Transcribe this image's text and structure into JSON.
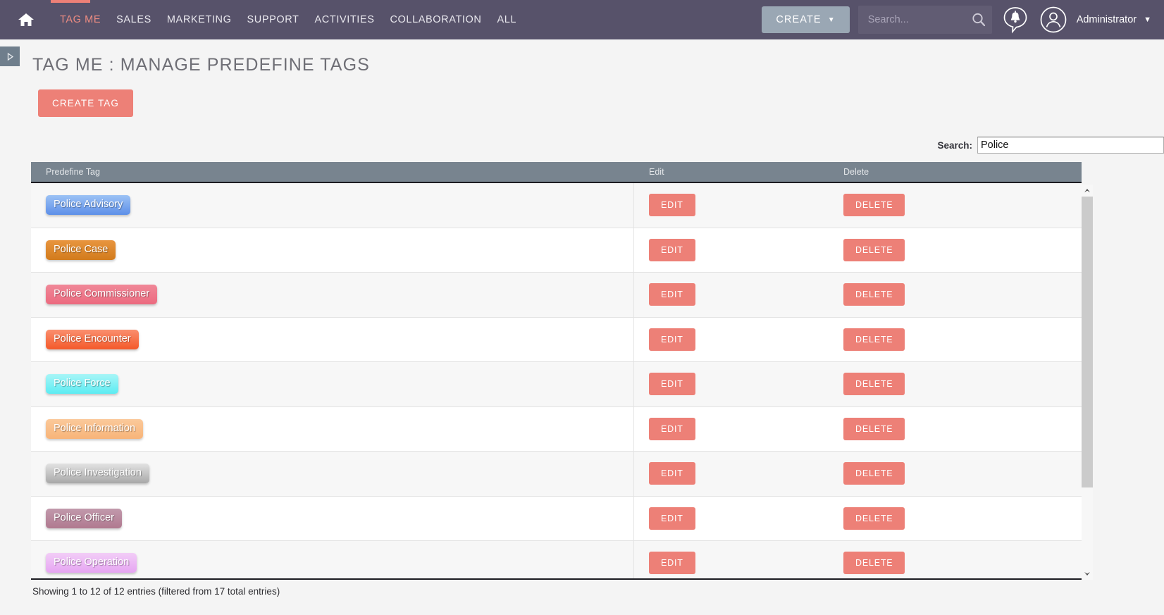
{
  "topnav": {
    "home_icon": "home-icon",
    "links": [
      {
        "label": "TAG ME",
        "active": true
      },
      {
        "label": "SALES",
        "active": false
      },
      {
        "label": "MARKETING",
        "active": false
      },
      {
        "label": "SUPPORT",
        "active": false
      },
      {
        "label": "ACTIVITIES",
        "active": false
      },
      {
        "label": "COLLABORATION",
        "active": false
      },
      {
        "label": "ALL",
        "active": false
      }
    ],
    "create_button": "CREATE",
    "create_caret": "▼",
    "search_placeholder": "Search...",
    "search_value": "",
    "search_icon": "search-icon",
    "notifications_icon": "notification-bell-icon",
    "account_icon": "user-avatar-icon",
    "account_name": "Administrator",
    "account_caret": "▼",
    "accent_color": "#ed8077",
    "bar_color": "#57526a"
  },
  "sidebar_toggle": {
    "icon": "expand-sidebar-icon",
    "glyph": "▷"
  },
  "page": {
    "title": "TAG ME : MANAGE PREDEFINE TAGS",
    "create_tag_label": "CREATE TAG"
  },
  "filter": {
    "label": "Search:",
    "value": "Police",
    "placeholder": ""
  },
  "table": {
    "columns": [
      "Predefine Tag",
      "Edit",
      "Delete"
    ],
    "edit_label": "EDIT",
    "delete_label": "DELETE",
    "rows": [
      {
        "tag": "Police Advisory",
        "color_top": "#9cc2f5",
        "color_bottom": "#5d8fe8"
      },
      {
        "tag": "Police Case",
        "color_top": "#e8953f",
        "color_bottom": "#d27b1c"
      },
      {
        "tag": "Police Commissioner",
        "color_top": "#f08898",
        "color_bottom": "#ec6a7f"
      },
      {
        "tag": "Police Encounter",
        "color_top": "#fa8f6e",
        "color_bottom": "#f4592a"
      },
      {
        "tag": "Police Force",
        "color_top": "#a8f5f7",
        "color_bottom": "#5cecf2"
      },
      {
        "tag": "Police Information",
        "color_top": "#fbc99a",
        "color_bottom": "#f7b479"
      },
      {
        "tag": "Police Investigation",
        "color_top": "#e2e2e2",
        "color_bottom": "#a8a8a8"
      },
      {
        "tag": "Police Officer",
        "color_top": "#c199ac",
        "color_bottom": "#b0798f"
      },
      {
        "tag": "Police Operation",
        "color_top": "#f2cdf7",
        "color_bottom": "#e6a5f2"
      }
    ],
    "footer": "Showing 1 to 12 of 12 entries (filtered from 17 total entries)"
  },
  "scrollbar": {
    "up_arrow": "scroll-up-icon",
    "down_arrow": "scroll-down-icon"
  }
}
